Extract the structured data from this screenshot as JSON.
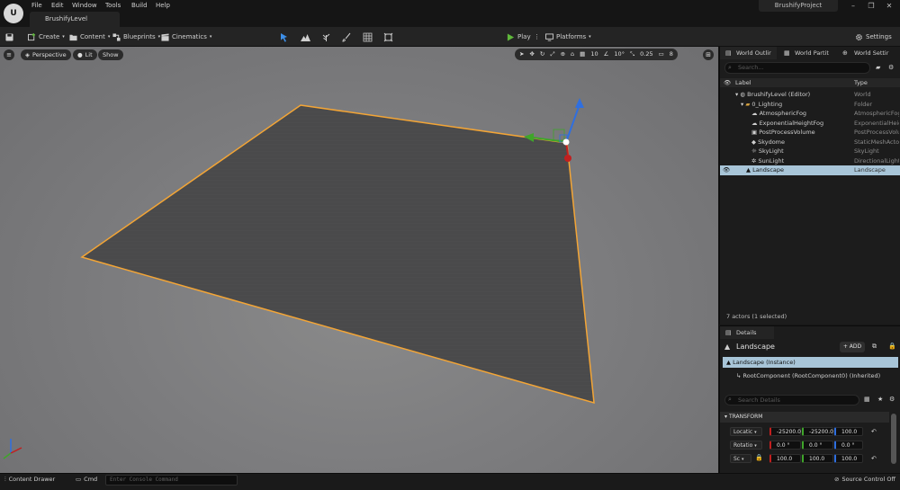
{
  "menu": {
    "items": [
      "File",
      "Edit",
      "Window",
      "Tools",
      "Build",
      "Help"
    ]
  },
  "level_tab": "BrushifyLevel",
  "project_name": "BrushifyProject",
  "toolbar": {
    "create": "Create",
    "content": "Content",
    "blueprints": "Blueprints",
    "cinematics": "Cinematics",
    "play": "Play",
    "platforms": "Platforms",
    "settings": "Settings"
  },
  "viewport": {
    "perspective": "Perspective",
    "lit": "Lit",
    "show": "Show",
    "grid_snap": "10",
    "rotation_snap": "10°",
    "scale_snap": "0.25",
    "camera_speed": "8"
  },
  "outliner": {
    "tabs": [
      "World Outlir",
      "World Partit",
      "World Settir"
    ],
    "search_placeholder": "Search...",
    "col_label": "Label",
    "col_type": "Type",
    "rows": [
      {
        "label": "BrushifyLevel (Editor)",
        "type": "World"
      },
      {
        "label": "0_Lighting",
        "type": "Folder"
      },
      {
        "label": "AtmosphericFog",
        "type": "AtmosphericFog"
      },
      {
        "label": "ExponentialHeightFog",
        "type": "ExponentialHeigh"
      },
      {
        "label": "PostProcessVolume",
        "type": "PostProcessVolu"
      },
      {
        "label": "Skydome",
        "type": "StaticMeshActor"
      },
      {
        "label": "SkyLight",
        "type": "SkyLight"
      },
      {
        "label": "SunLight",
        "type": "DirectionalLight"
      },
      {
        "label": "Landscape",
        "type": "Landscape"
      }
    ],
    "actor_count": "7 actors (1 selected)"
  },
  "details": {
    "tab": "Details",
    "actor_name": "Landscape",
    "add_label": "+ ADD",
    "instance_label": "Landscape (Instance)",
    "root_component": "RootComponent (RootComponent0) (Inherited)",
    "search_placeholder": "Search Details",
    "section": "TRANSFORM",
    "location_label": "Locatic",
    "rotation_label": "Rotatio",
    "scale_label": "Sc",
    "location": [
      "-25200.0",
      "-25200.0",
      "100.0"
    ],
    "rotation": [
      "0.0 °",
      "0.0 °",
      "0.0 °"
    ],
    "scale": [
      "100.0",
      "100.0",
      "100.0"
    ]
  },
  "bottom": {
    "content_drawer": "Content Drawer",
    "cmd": "Cmd",
    "console_placeholder": "Enter Console Command",
    "source_control": "Source Control Off"
  },
  "colors": {
    "selection_outline": "#f3a536",
    "selected_row": "#a8c5d8",
    "play_green": "#5fb83b",
    "gizmo_x": "#c21f1f",
    "gizmo_y": "#3fa52a",
    "gizmo_z": "#2f6fe0"
  }
}
